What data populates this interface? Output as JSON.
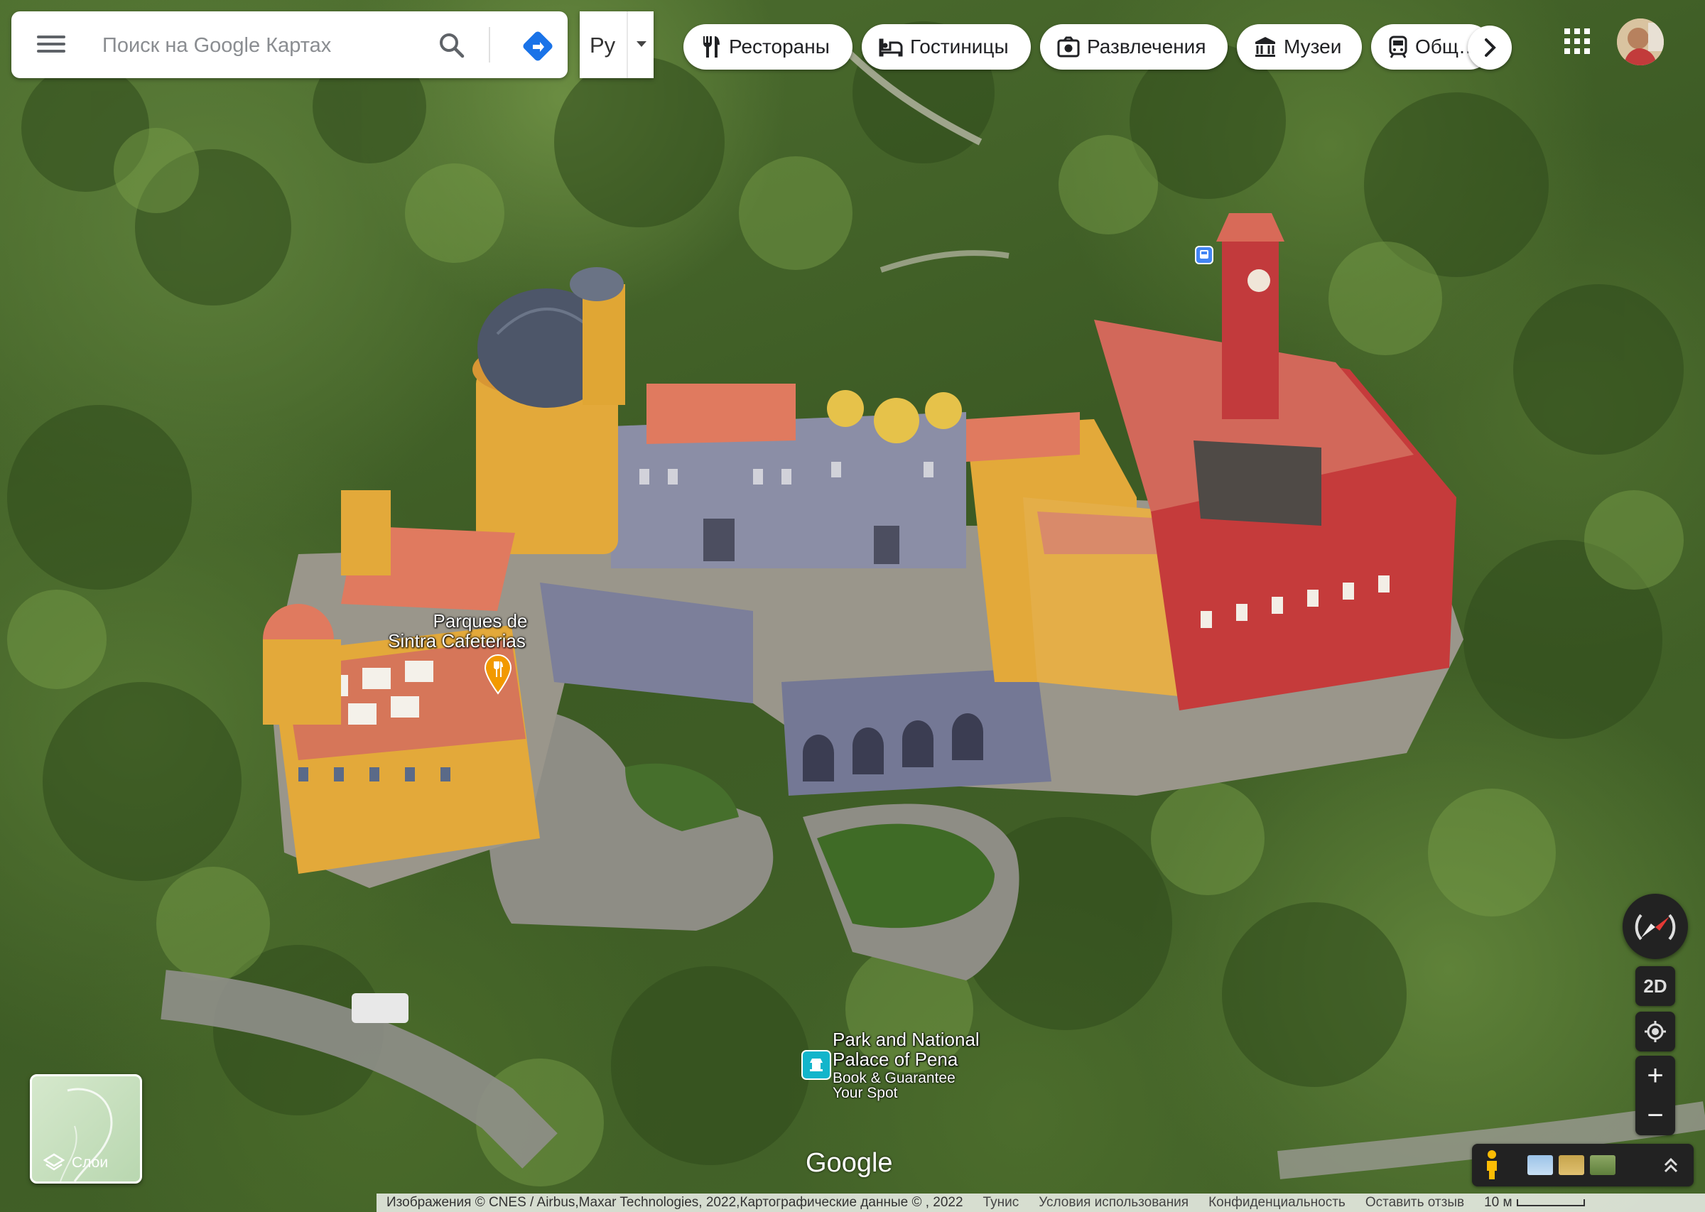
{
  "search": {
    "placeholder": "Поиск на Google Картах"
  },
  "language": {
    "selected": "Ру"
  },
  "chips": [
    {
      "label": "Рестораны",
      "icon": "restaurant-icon"
    },
    {
      "label": "Гостиницы",
      "icon": "hotel-icon"
    },
    {
      "label": "Развлечения",
      "icon": "camera-icon"
    },
    {
      "label": "Музеи",
      "icon": "museum-icon"
    },
    {
      "label": "Общ…",
      "icon": "transit-icon"
    }
  ],
  "places": [
    {
      "name_line1": "Parques de",
      "name_line2": "Sintra Cafeterias",
      "type": "restaurant"
    },
    {
      "name_line1": "Park and National",
      "name_line2": "Palace of Pena",
      "sub_line1": "Book & Guarantee",
      "sub_line2": "Your Spot",
      "type": "landmark"
    }
  ],
  "controls": {
    "view_toggle": "2D",
    "zoom_in": "+",
    "zoom_out": "−"
  },
  "layers": {
    "label": "Слои"
  },
  "logo": "Google",
  "footer": {
    "attribution": "Изображения © CNES / Airbus,Maxar Technologies, 2022,Картографические данные © , 2022",
    "country": "Тунис",
    "terms": "Условия использования",
    "privacy": "Конфиденциальность",
    "feedback": "Оставить отзыв",
    "scale": "10 м"
  },
  "colors": {
    "accent_blue": "#1a73e8",
    "restaurant_pin": "#f29900",
    "landmark_pin": "#12b5cb",
    "transit_pin": "#4285f4"
  }
}
